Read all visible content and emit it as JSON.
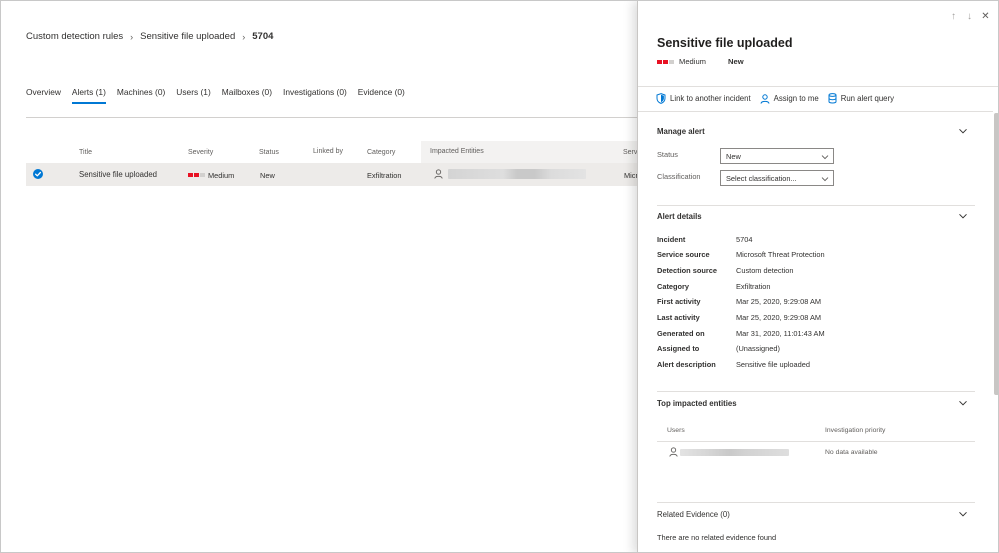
{
  "breadcrumb": {
    "items": [
      "Custom detection rules",
      "Sensitive file uploaded"
    ],
    "current": "5704"
  },
  "tabs": [
    {
      "label": "Overview"
    },
    {
      "label": "Alerts (1)",
      "active": true
    },
    {
      "label": "Machines (0)"
    },
    {
      "label": "Users (1)"
    },
    {
      "label": "Mailboxes (0)"
    },
    {
      "label": "Investigations (0)"
    },
    {
      "label": "Evidence (0)"
    }
  ],
  "table": {
    "columns": {
      "title": "Title",
      "severity": "Severity",
      "status": "Status",
      "linked_by": "Linked by",
      "category": "Category",
      "impacted": "Impacted Entities",
      "service": "Servi"
    },
    "row": {
      "title": "Sensitive file uploaded",
      "severity": "Medium",
      "status": "New",
      "category": "Exfiltration",
      "service": "Micr"
    }
  },
  "panel": {
    "title": "Sensitive file uploaded",
    "severity": "Medium",
    "status": "New",
    "actions": {
      "link": "Link to another incident",
      "assign": "Assign to me",
      "run": "Run alert query"
    },
    "manage": {
      "title": "Manage alert",
      "status_label": "Status",
      "status_value": "New",
      "classification_label": "Classification",
      "classification_value": "Select classification..."
    },
    "details": {
      "title": "Alert details",
      "rows": [
        {
          "label": "Incident",
          "value": "5704"
        },
        {
          "label": "Service source",
          "value": "Microsoft Threat Protection"
        },
        {
          "label": "Detection source",
          "value": "Custom detection"
        },
        {
          "label": "Category",
          "value": "Exfiltration"
        },
        {
          "label": "First activity",
          "value": "Mar 25, 2020, 9:29:08 AM"
        },
        {
          "label": "Last activity",
          "value": "Mar 25, 2020, 9:29:08 AM"
        },
        {
          "label": "Generated on",
          "value": "Mar 31, 2020, 11:01:43 AM"
        },
        {
          "label": "Assigned to",
          "value": "(Unassigned)"
        },
        {
          "label": "Alert description",
          "value": "Sensitive file uploaded"
        }
      ]
    },
    "entities": {
      "title": "Top impacted entities",
      "users_header": "Users",
      "priority_header": "Investigation priority",
      "no_data": "No data available"
    },
    "evidence": {
      "title": "Related Evidence (0)",
      "empty": "There are no related evidence found"
    }
  },
  "colors": {
    "accent": "#0078d4",
    "severity_medium": "#e81123",
    "severity_empty": "#d2d0ce",
    "selected_row": "#edebe9"
  }
}
